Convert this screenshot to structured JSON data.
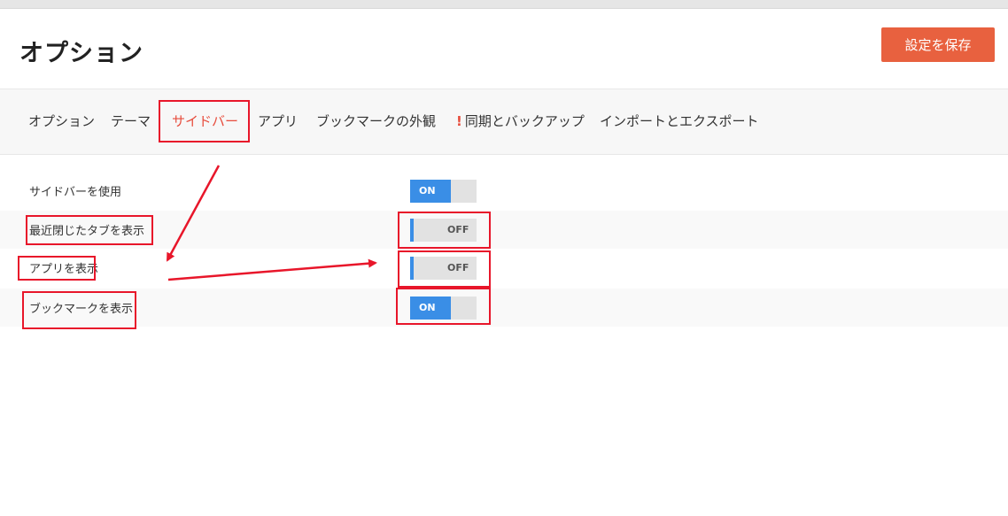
{
  "header": {
    "title": "オプション",
    "save_label": "設定を保存"
  },
  "tabs": [
    {
      "label": "オプション",
      "active": false
    },
    {
      "label": "テーマ",
      "active": false
    },
    {
      "label": "サイドバー",
      "active": true
    },
    {
      "label": "アプリ",
      "active": false
    },
    {
      "label": "ブックマークの外観",
      "active": false
    },
    {
      "label": "同期とバックアップ",
      "active": false,
      "warning": "!"
    },
    {
      "label": "インポートとエクスポート",
      "active": false
    }
  ],
  "settings": [
    {
      "label": "サイドバーを使用",
      "state": "ON"
    },
    {
      "label": "最近閉じたタブを表示",
      "state": "OFF"
    },
    {
      "label": "アプリを表示",
      "state": "OFF"
    },
    {
      "label": "ブックマークを表示",
      "state": "ON"
    }
  ],
  "colors": {
    "accent": "#e8613f",
    "toggle_on": "#3a8ee6",
    "active_tab": "#e74c3c",
    "annotation": "#e8162a"
  }
}
